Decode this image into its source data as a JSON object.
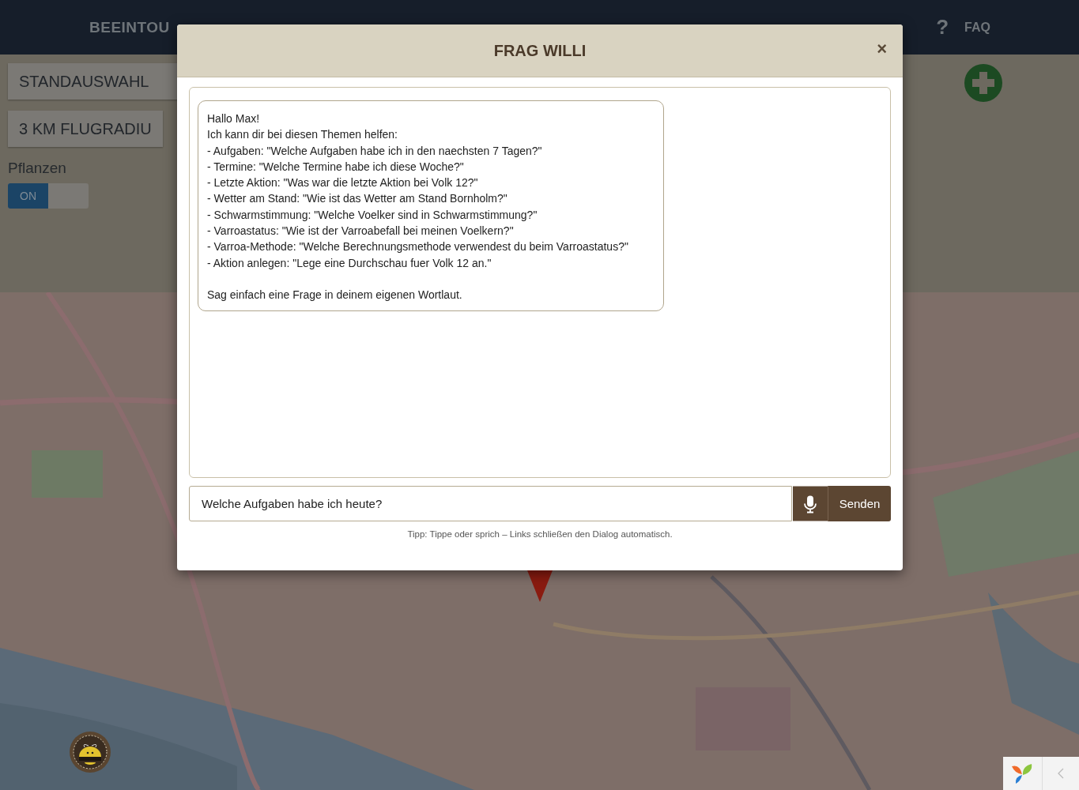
{
  "nav": {
    "brand": "BEEINTOU",
    "help_glyph": "?",
    "faq": "FAQ"
  },
  "controls": {
    "location_button": "STANDAUSWAHL",
    "radius_dropdown": "3 KM FLUGRADIU",
    "plants_label": "Pflanzen",
    "plants_toggle": {
      "label": "ON",
      "on": true
    }
  },
  "dialog": {
    "title": "FRAG WILLI",
    "close": "×",
    "messages": [
      {
        "lines": [
          "Hallo Max!",
          "Ich kann dir bei diesen Themen helfen:",
          "- Aufgaben: \"Welche Aufgaben habe ich in den naechsten 7 Tagen?\"",
          "- Termine: \"Welche Termine habe ich diese Woche?\"",
          "- Letzte Aktion: \"Was war die letzte Aktion bei Volk 12?\"",
          "- Wetter am Stand: \"Wie ist das Wetter am Stand Bornholm?\"",
          "- Schwarmstimmung: \"Welche Voelker sind in Schwarmstimmung?\"",
          "- Varroastatus: \"Wie ist der Varroabefall bei meinen Voelkern?\"",
          "- Varroa-Methode: \"Welche Berechnungsmethode verwendest du beim Varroastatus?\"",
          "- Aktion anlegen: \"Lege eine Durchschau fuer Volk 12 an.\""
        ],
        "closing": "Sag einfach eine Frage in deinem eigenen Wortlaut."
      }
    ],
    "input": {
      "value": "Welche Aufgaben habe ich heute?"
    },
    "send_button": "Senden",
    "tip": "Tipp: Tippe oder sprich – Links schließen den Dialog automatisch."
  }
}
